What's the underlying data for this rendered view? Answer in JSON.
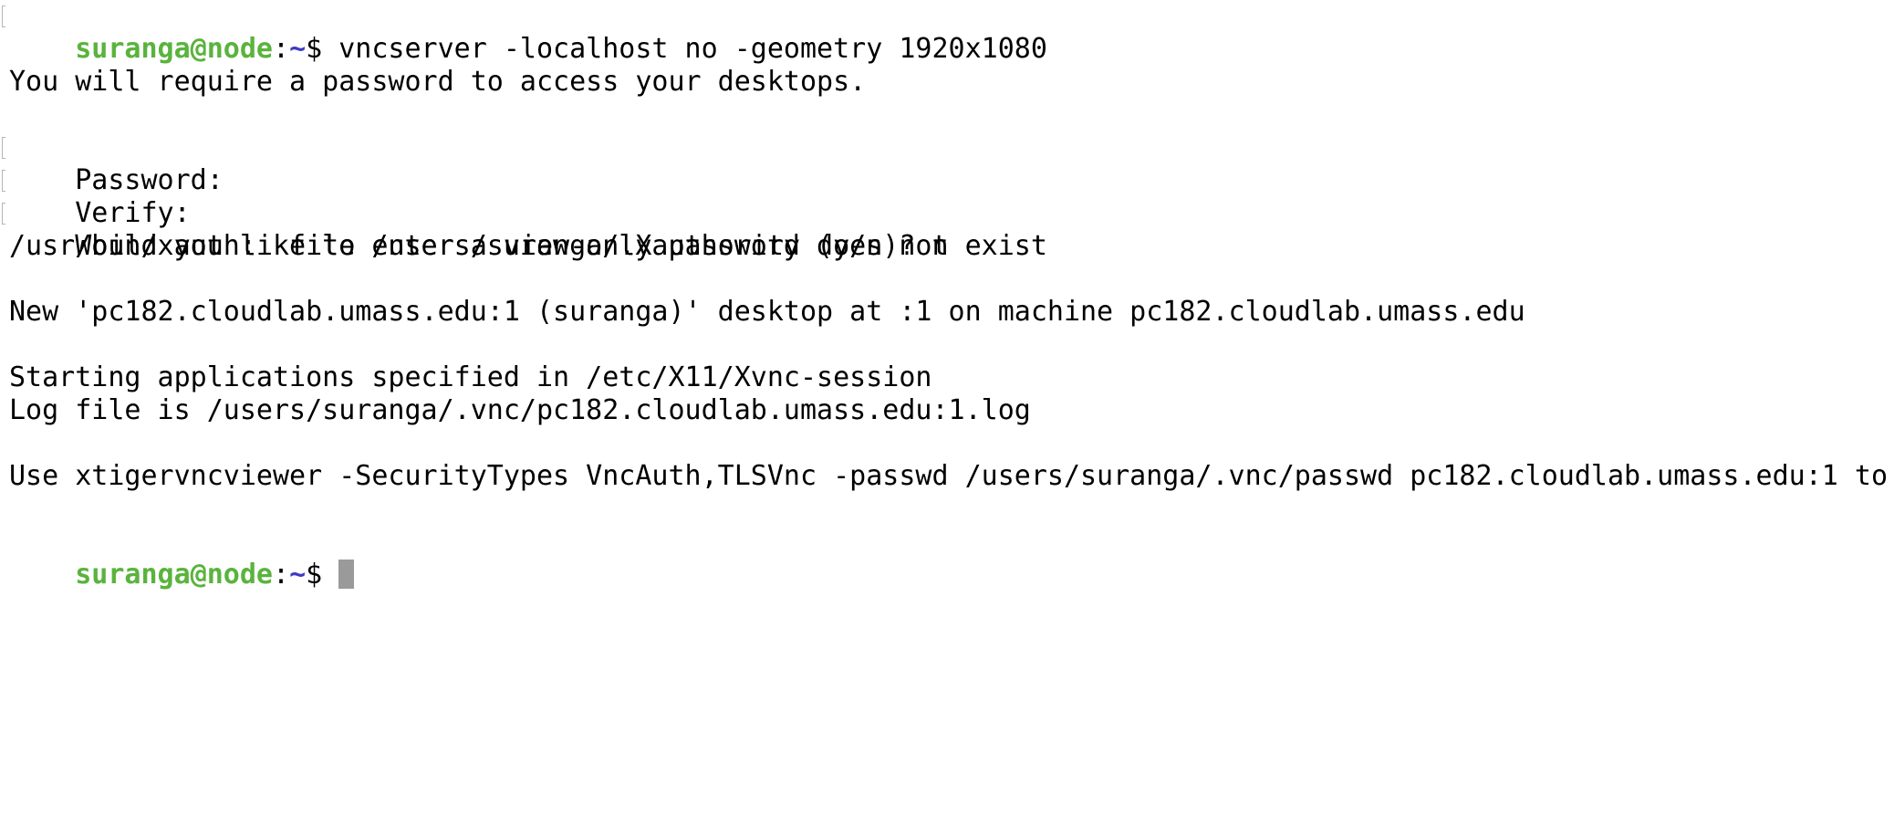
{
  "prompt": {
    "user_host": "suranga@node",
    "separator": ":",
    "path": "~",
    "sign": "$ "
  },
  "command": "vncserver -localhost no -geometry 1920x1080",
  "output": {
    "require_password": "You will require a password to access your desktops.",
    "password_prompt": "Password:",
    "verify_prompt": "Verify:",
    "view_only_prompt": "Would you like to enter a view-only password (y/n)? n",
    "xauth_msg": "/usr/bin/xauth:  file /users/suranga/.Xauthority does not exist",
    "new_desktop": "New 'pc182.cloudlab.umass.edu:1 (suranga)' desktop at :1 on machine pc182.cloudlab.umass.edu",
    "starting_apps": "Starting applications specified in /etc/X11/Xvnc-session",
    "log_file": "Log file is /users/suranga/.vnc/pc182.cloudlab.umass.edu:1.log",
    "use_viewer": "Use xtigervncviewer -SecurityTypes VncAuth,TLSVnc -passwd /users/suranga/.vnc/passwd pc182.cloudlab.umass.edu:1 to"
  }
}
